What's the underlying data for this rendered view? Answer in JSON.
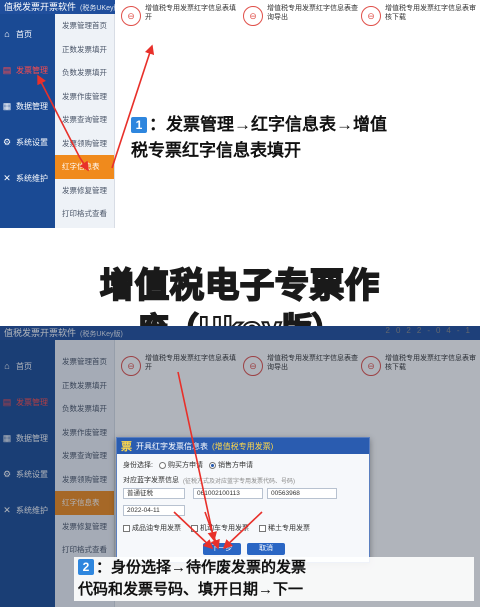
{
  "app": {
    "title": "值税发票开票软件",
    "title_sub": "(税务UKey版)",
    "window_controls": "? — ✕"
  },
  "sidebar": {
    "items": [
      {
        "label": "首页",
        "icon": "home-icon"
      },
      {
        "label": "发票管理",
        "icon": "invoice-icon"
      },
      {
        "label": "数据管理",
        "icon": "data-icon"
      },
      {
        "label": "系统设置",
        "icon": "settings-icon"
      },
      {
        "label": "系统维护",
        "icon": "tools-icon"
      }
    ]
  },
  "submenu": {
    "items": [
      "发票管理首页",
      "正数发票填开",
      "负数发票填开",
      "发票作废管理",
      "发票查询管理",
      "发票领购管理",
      "红字信息表",
      "发票修复管理",
      "打印格式查看"
    ]
  },
  "cards": [
    {
      "label": "增值税专用发票红字信息表填开"
    },
    {
      "label": "增值税专用发票红字信息表查询导出"
    },
    {
      "label": "增值税专用发票红字信息表审核下载"
    }
  ],
  "top_right": "2022-04-1",
  "step1": {
    "badge": "1",
    "line1": "：发票管理→红字信息表→增值",
    "line2": "税专票红字信息表填开"
  },
  "overlay_title": {
    "line1": "增值税电子专票作",
    "line2": "废（Ukey版）"
  },
  "dialog": {
    "title": "开具红字发票信息表",
    "title_tag": "(增值税专用发票)",
    "identity_label": "身份选择:",
    "option_buyer": "购买方申请",
    "option_seller": "销售方申请",
    "section_label": "对应蓝字发票信息",
    "section_hint": "(征税方式及对应蓝字专用发票代码、号码)",
    "tax_method": "普通征税",
    "invoice_code": "061002100113",
    "invoice_number": "00563968",
    "date": "2022-04-11",
    "check1": "成品油专用发票",
    "check2": "机动车专用发票",
    "check3": "稀土专用发票",
    "next_button": "下一步",
    "cancel_button": "取消"
  },
  "step2": {
    "badge": "2",
    "line1": "：身份选择→待作废发票的发票",
    "line2": "代码和发票号码、填开日期→下一"
  },
  "colors": {
    "sidebar": "#1a4a94",
    "active_submenu": "#f08a1c",
    "arrow": "#e8302a",
    "badge": "#2e86de"
  }
}
